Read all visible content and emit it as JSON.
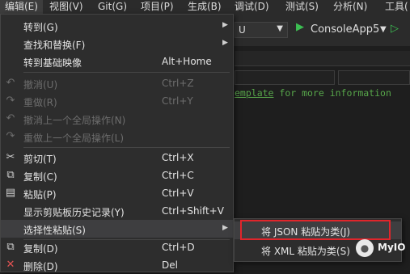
{
  "menubar": {
    "items": [
      "编辑(E)",
      "视图(V)",
      "Git(G)",
      "项目(P)",
      "生成(B)",
      "调试(D)",
      "测试(S)",
      "分析(N)",
      "工具("
    ]
  },
  "toolbar": {
    "config_value": "U",
    "run_target": "ConsoleApp5"
  },
  "editor": {
    "code_link": "emplate",
    "code_rest": " for more information"
  },
  "edit_menu": {
    "items": [
      {
        "label": "转到(G)",
        "shortcut": "",
        "icon": "",
        "has_submenu": true,
        "disabled": false
      },
      {
        "label": "查找和替换(F)",
        "shortcut": "",
        "icon": "",
        "has_submenu": true,
        "disabled": false
      },
      {
        "label": "转到基础映像",
        "shortcut": "Alt+Home",
        "icon": "",
        "has_submenu": false,
        "disabled": false
      },
      {
        "label": "撤消(U)",
        "shortcut": "Ctrl+Z",
        "icon": "undo-icon",
        "has_submenu": false,
        "disabled": true
      },
      {
        "label": "重做(R)",
        "shortcut": "Ctrl+Y",
        "icon": "redo-icon",
        "has_submenu": false,
        "disabled": true
      },
      {
        "label": "撤消上一个全局操作(N)",
        "shortcut": "",
        "icon": "undo-global-icon",
        "has_submenu": false,
        "disabled": true
      },
      {
        "label": "重做上一个全局操作(L)",
        "shortcut": "",
        "icon": "redo-global-icon",
        "has_submenu": false,
        "disabled": true
      },
      {
        "label": "剪切(T)",
        "shortcut": "Ctrl+X",
        "icon": "scissors-icon",
        "has_submenu": false,
        "disabled": false
      },
      {
        "label": "复制(C)",
        "shortcut": "Ctrl+C",
        "icon": "copy-icon",
        "has_submenu": false,
        "disabled": false
      },
      {
        "label": "粘贴(P)",
        "shortcut": "Ctrl+V",
        "icon": "paste-icon",
        "has_submenu": false,
        "disabled": false
      },
      {
        "label": "显示剪贴板历史记录(Y)",
        "shortcut": "Ctrl+Shift+V",
        "icon": "",
        "has_submenu": false,
        "disabled": false
      },
      {
        "label": "选择性粘贴(S)",
        "shortcut": "",
        "icon": "",
        "has_submenu": true,
        "disabled": false,
        "highlighted": true
      },
      {
        "label": "复制(D)",
        "shortcut": "Ctrl+D",
        "icon": "duplicate-icon",
        "has_submenu": false,
        "disabled": false
      },
      {
        "label": "删除(D)",
        "shortcut": "Del",
        "icon": "delete-icon",
        "has_submenu": false,
        "disabled": false
      }
    ]
  },
  "paste_special_menu": {
    "items": [
      {
        "label": "将 JSON 粘贴为类(J)",
        "highlighted": true
      },
      {
        "label": "将 XML 粘贴为类(S)",
        "highlighted": false
      }
    ]
  },
  "watermark": {
    "text": "MyIO"
  },
  "colors": {
    "highlight_border": "#e0252b",
    "play_green": "#3cbe52",
    "comment_green": "#57a64a"
  }
}
